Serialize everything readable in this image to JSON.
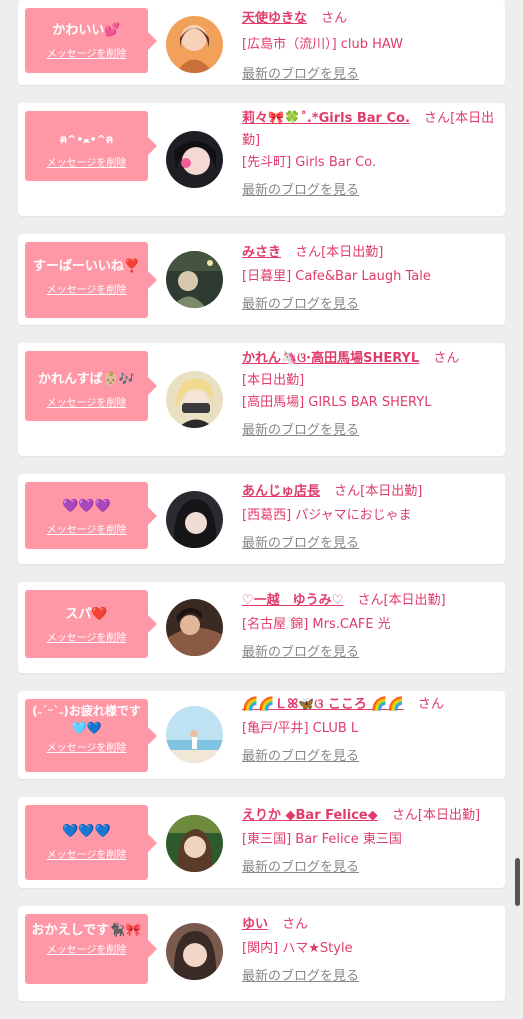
{
  "cards": [
    {
      "message": "かわいい💕",
      "delete_label": "メッセージを削除",
      "name": "天使ゆきな",
      "san": "さん",
      "status": "",
      "shop": "[広島市（流川）] club HAW",
      "blog_label": "最新のブログを見る",
      "avatar_colors": [
        "#f2a15a",
        "#c96f3a",
        "#f8d2b8"
      ]
    },
    {
      "message": "ฅ^•ﻌ•^ฅ",
      "delete_label": "メッセージを削除",
      "name": "莉々🎀🍀˚.*Girls Bar Co.",
      "san": "さん",
      "status": "[本日出勤]",
      "shop": "[先斗町] Girls Bar Co.",
      "blog_label": "最新のブログを見る",
      "avatar_colors": [
        "#1e1e24",
        "#f05d9a",
        "#f4d9d2"
      ]
    },
    {
      "message": "すーぱーいいね❣️",
      "delete_label": "メッセージを削除",
      "name": "みさき",
      "san": "さん",
      "status": "[本日出勤]",
      "shop": "[日暮里] Cafe&Bar Laugh Tale",
      "blog_label": "最新のブログを見る",
      "avatar_colors": [
        "#2f3a30",
        "#7c8a6a",
        "#d9c8b0"
      ]
    },
    {
      "message": "かれんすば👶🏼🎶",
      "delete_label": "メッセージを削除",
      "name": "かれん🦄ଓ·高田馬場SHERYL",
      "san": "さん",
      "status": "[本日出勤]",
      "shop": "[高田馬場] GIRLS BAR SHERYL",
      "blog_label": "最新のブログを見る",
      "avatar_colors": [
        "#e9dfc3",
        "#f1d98d",
        "#3a3a3a"
      ]
    },
    {
      "message": "💜💜💜",
      "delete_label": "メッセージを削除",
      "name": "あんじゅ店長",
      "san": "さん",
      "status": "[本日出勤]",
      "shop": "[西葛西] パジャマにおじゃま",
      "blog_label": "最新のブログを見る",
      "avatar_colors": [
        "#2a2a30",
        "#151518",
        "#efdcd2"
      ]
    },
    {
      "message": "スパ❤️",
      "delete_label": "メッセージを削除",
      "name": "♡一越　ゆうみ♡",
      "san": "さん",
      "status": "[本日出勤]",
      "shop": "[名古屋 錦] Mrs.CAFE 光",
      "blog_label": "最新のブログを見る",
      "avatar_colors": [
        "#3b2a22",
        "#8a5a44",
        "#e3b79a"
      ]
    },
    {
      "message": "(˶ˊᵕˋ˵)お疲れ様です🩵💙",
      "delete_label": "メッセージを削除",
      "name": "🌈🌈Ｌꕤ🦋ଓ こころ 🌈🌈",
      "san": "さん",
      "status": "",
      "shop": "[亀戸/平井] CLUB L",
      "blog_label": "最新のブログを見る",
      "avatar_colors": [
        "#bfe2f2",
        "#7ec3e0",
        "#f2e6d6"
      ]
    },
    {
      "message": "💙💙💙",
      "delete_label": "メッセージを削除",
      "name": "えりか ◆Bar Felice◆",
      "san": "さん",
      "status": "[本日出勤]",
      "shop": "[東三国] Bar Felice 東三国",
      "blog_label": "最新のブログを見る",
      "avatar_colors": [
        "#2f5a2e",
        "#6d8a3d",
        "#f0d2c0"
      ]
    },
    {
      "message": "おかえしです🐈‍⬛🎀",
      "delete_label": "メッセージを削除",
      "name": "ゆい",
      "san": "さん",
      "status": "",
      "shop": "[関内] ハマ★Style",
      "blog_label": "最新のブログを見る",
      "avatar_colors": [
        "#3b2b27",
        "#7b5a4e",
        "#f1d6c8"
      ]
    }
  ]
}
